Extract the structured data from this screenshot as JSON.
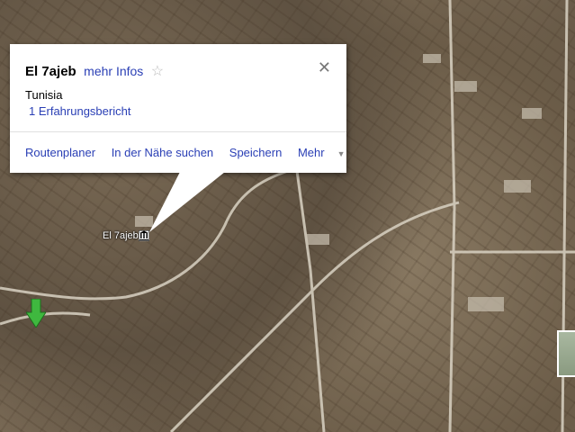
{
  "map": {
    "type": "satellite",
    "marker_label": "El 7ajeb",
    "marker_icon": "museum-icon",
    "pin_icon": "green-arrow-icon",
    "pin_color": "#3fb83f"
  },
  "infowindow": {
    "title": "El 7ajeb",
    "more_info": "mehr Infos",
    "country": "Tunisia",
    "reviews": "1 Erfahrungsbericht",
    "actions": [
      "Routenplaner",
      "In der Nähe suchen",
      "Speichern",
      "Mehr"
    ],
    "close_icon": "close-icon",
    "star_icon": "star-icon",
    "link_color": "#2a3fb5"
  }
}
